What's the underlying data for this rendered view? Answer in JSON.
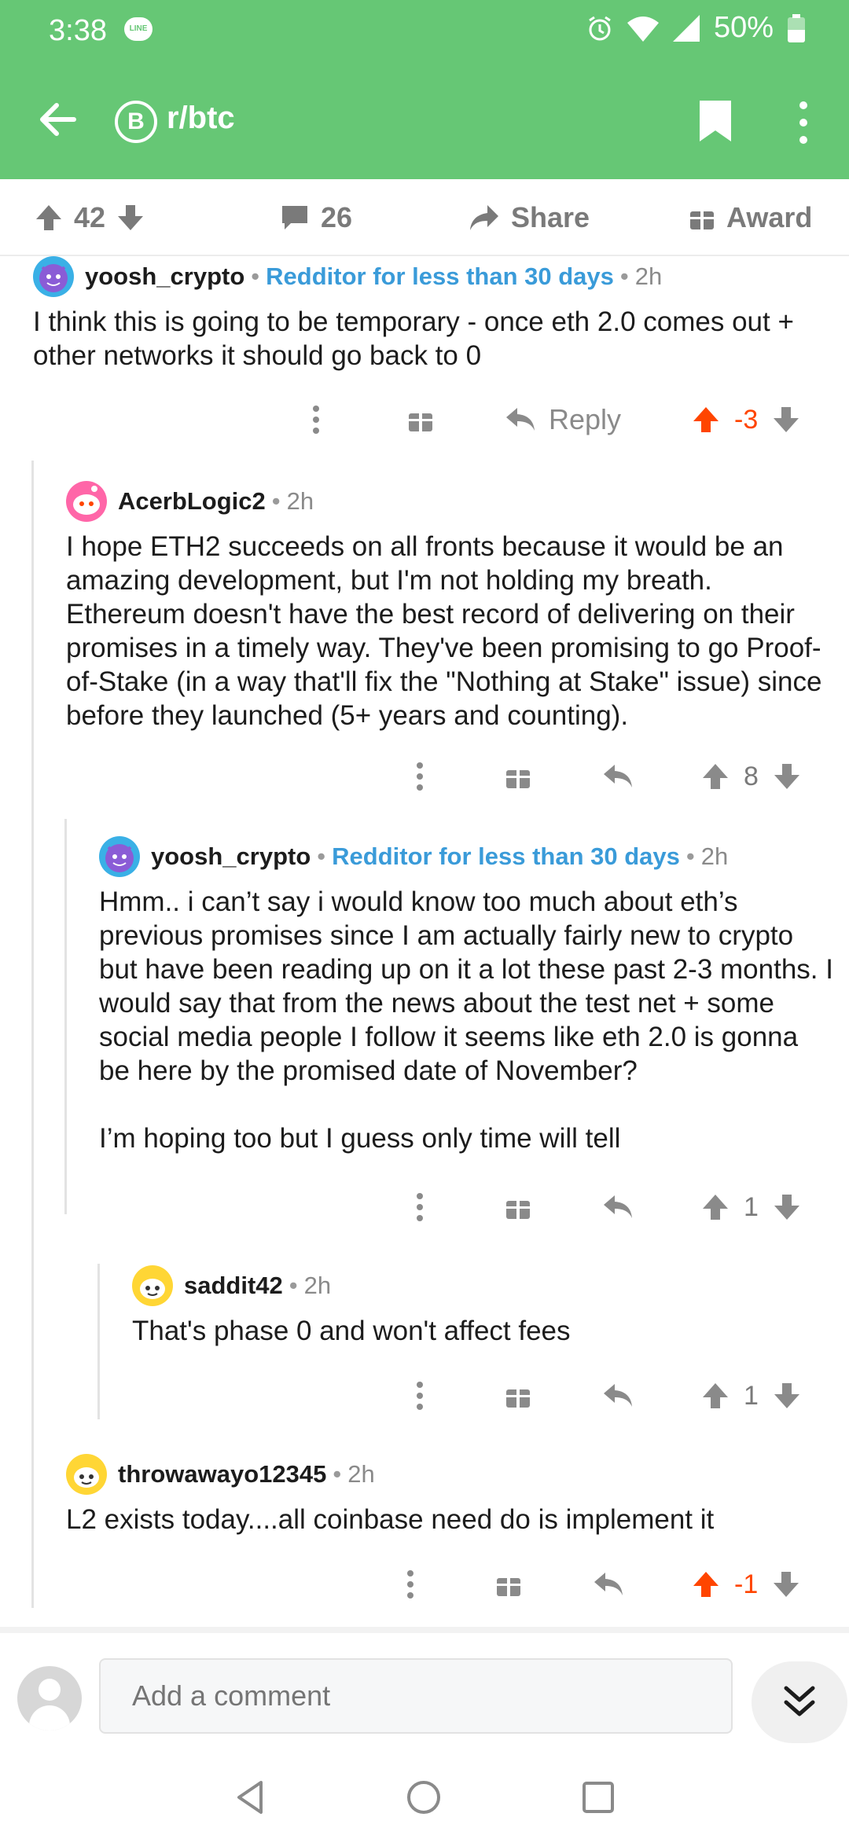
{
  "status": {
    "time": "3:38",
    "line": "LINE",
    "battery": "50%",
    "battery_level": 0.5
  },
  "appbar": {
    "subreddit": "r/btc",
    "sub_glyph": "B"
  },
  "postbar": {
    "upvotes": "42",
    "comments": "26",
    "share": "Share",
    "award": "Award"
  },
  "comments": [
    {
      "user": "yoosh_crypto",
      "flair": "Redditor for less than 30 days",
      "age": "2h",
      "body": "I think this is going to be temporary - once eth 2.0 comes out + other networks it should go back to 0",
      "reply_label": "Reply",
      "score": "-3"
    },
    {
      "user": "AcerbLogic2",
      "age": "2h",
      "body": "I hope ETH2 succeeds on all fronts because it would be an amazing development, but I'm not holding my breath. Ethereum doesn't have the best record of delivering on their promises in a timely way. They've been promising to go Proof-of-Stake (in a way that'll fix the \"Nothing at Stake\" issue) since before they launched (5+ years and counting).",
      "score": "8"
    },
    {
      "user": "yoosh_crypto",
      "flair": "Redditor for less than 30 days",
      "age": "2h",
      "body": "Hmm.. i can’t say i would know too much about eth’s previous promises since I am actually fairly new to crypto but have been reading up on it a lot these past 2-3 months. I would say that from the news about the test net + some social media people I follow it seems like eth 2.0 is gonna be here by the promised date of November?\n\nI’m hoping too but I guess only time will tell",
      "score": "1"
    },
    {
      "user": "saddit42",
      "age": "2h",
      "body": "That's phase 0 and won't affect fees",
      "score": "1"
    },
    {
      "user": "throwawayo12345",
      "age": "2h",
      "body": "L2 exists today....all coinbase need do is implement it",
      "score": "-1"
    }
  ],
  "compose": {
    "placeholder": "Add a comment"
  },
  "colors": {
    "header": "#66c775",
    "upvote_active": "#ff4500",
    "flair": "#3a9bd9"
  }
}
